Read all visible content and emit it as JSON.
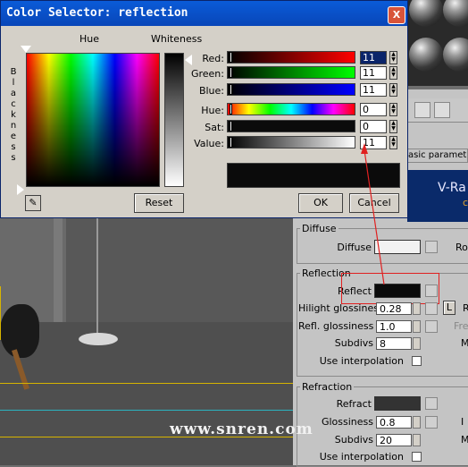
{
  "dialog": {
    "title": "Color Selector: reflection",
    "close_label": "X",
    "hue_header": "Hue",
    "whiteness_header": "Whiteness",
    "blackness_letters": [
      "B",
      "l",
      "a",
      "c",
      "k",
      "n",
      "e",
      "s",
      "s"
    ],
    "sliders": [
      {
        "label": "Red:",
        "value": "11",
        "selected": true
      },
      {
        "label": "Green:",
        "value": "11",
        "selected": false
      },
      {
        "label": "Blue:",
        "value": "11",
        "selected": false
      },
      {
        "label": "Hue:",
        "value": "0",
        "selected": false
      },
      {
        "label": "Sat:",
        "value": "0",
        "selected": false
      },
      {
        "label": "Value:",
        "value": "11",
        "selected": false
      }
    ],
    "reset_label": "Reset",
    "ok_label": "OK",
    "cancel_label": "Cancel",
    "preview_color": "#0b0b0b"
  },
  "right_panel": {
    "banner_title": "V-Ra",
    "banner_sub": "c",
    "rollout_header": "asic parameter",
    "diffuse_group": {
      "title": "Diffuse",
      "diffuse_label": "Diffuse",
      "partial_label": "Ro"
    },
    "reflection_group": {
      "title": "Reflection",
      "reflect_label": "Reflect",
      "hilight_label": "Hilight glossiness",
      "hilight_value": "0.28",
      "lock_label": "L",
      "partial_r": "R",
      "refl_gloss_label": "Refl. glossiness",
      "refl_gloss_value": "1.0",
      "partial_fre": "Fre",
      "subdivs_label": "Subdivs",
      "subdivs_value": "8",
      "partial_m": "M",
      "use_interp_label": "Use interpolation"
    },
    "refraction_group": {
      "title": "Refraction",
      "refract_label": "Refract",
      "gloss_label": "Glossiness",
      "gloss_value": "0.8",
      "partial_i": "I",
      "subdivs_label": "Subdivs",
      "subdivs_value": "20",
      "partial_m": "M",
      "use_interp_label": "Use interpolation"
    }
  },
  "watermark": "www.snren.com",
  "colors": {
    "annotation": "#e02020",
    "title_bar": "#0a5bd8",
    "reflect_swatch": "#0b0b0b",
    "refract_swatch": "#333333",
    "diffuse_swatch": "#f2f2f2"
  }
}
